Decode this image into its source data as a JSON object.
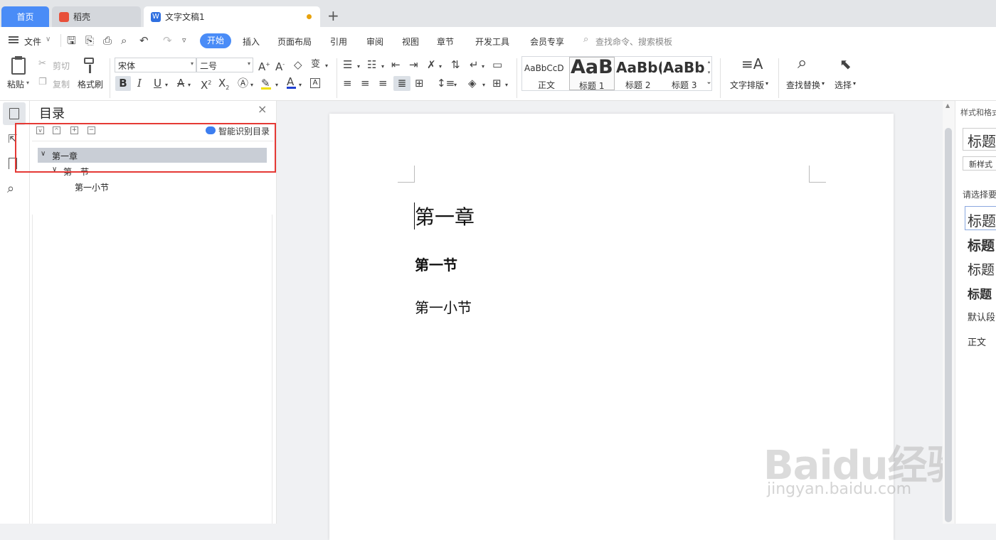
{
  "tabs": {
    "home": "首页",
    "daoke": "稻壳",
    "doc": "文字文稿1",
    "add": "+"
  },
  "menu": {
    "file": "文件",
    "start": "开始",
    "insert": "插入",
    "layout": "页面布局",
    "reference": "引用",
    "review": "审阅",
    "view": "视图",
    "section": "章节",
    "devtools": "开发工具",
    "vip": "会员专享",
    "search_placeholder": "查找命令、搜索模板"
  },
  "ribbon": {
    "paste": "粘贴",
    "cut": "剪切",
    "copy": "复制",
    "format_painter": "格式刷",
    "font_name": "宋体",
    "font_size": "二号",
    "style_previews": [
      {
        "preview": "AaBbCcD",
        "label": "正文"
      },
      {
        "preview": "AaB",
        "label": "标题 1"
      },
      {
        "preview": "AaBb(",
        "label": "标题 2"
      },
      {
        "preview": "AaBb(",
        "label": "标题 3"
      }
    ],
    "text_layout": "文字排版",
    "find_replace": "查找替换",
    "select": "选择"
  },
  "nav": {
    "title": "目录",
    "smart_toc": "智能识别目录",
    "items": [
      {
        "label": "第一章",
        "level": 1
      },
      {
        "label": "第一节",
        "level": 2
      },
      {
        "label": "第一小节",
        "level": 3
      }
    ]
  },
  "document": {
    "h1": "第一章",
    "h2": "第一节",
    "h3": "第一小节"
  },
  "right_panel": {
    "title": "样式和格式",
    "current_style": "标题",
    "new_style": "新样式",
    "choose_label": "请选择要",
    "styles": [
      "标题",
      "标题",
      "标题",
      "标题",
      "默认段",
      "正文"
    ]
  },
  "watermark": {
    "brand": "Baidu经验",
    "url": "jingyan.baidu.com"
  },
  "colors": {
    "accent": "#4a8cf7",
    "highlight_box": "#e53935",
    "tree_selected": "#c9ced6"
  }
}
